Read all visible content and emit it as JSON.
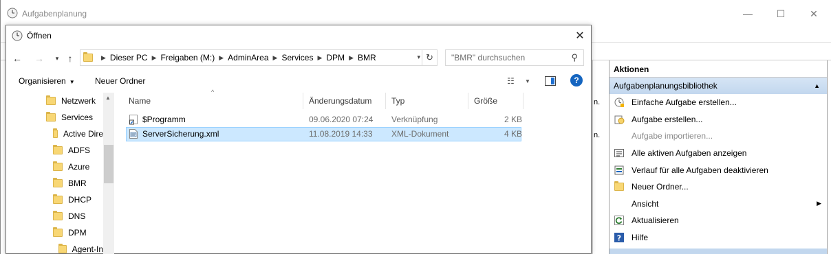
{
  "background_window": {
    "title": "Aufgabenplanung",
    "controls": {
      "minimize": "—",
      "maximize": "☐",
      "close": "✕"
    },
    "strip_text": [
      "n.",
      "n."
    ]
  },
  "actions_panel": {
    "header": "Aktionen",
    "group_title": "Aufgabenplanungsbibliothek",
    "items": [
      {
        "label": "Einfache Aufgabe erstellen...",
        "icon": "wizard-icon",
        "enabled": true
      },
      {
        "label": "Aufgabe erstellen...",
        "icon": "task-icon",
        "enabled": true
      },
      {
        "label": "Aufgabe importieren...",
        "icon": "",
        "enabled": false
      },
      {
        "label": "Alle aktiven Aufgaben anzeigen",
        "icon": "list-icon",
        "enabled": true
      },
      {
        "label": "Verlauf für alle Aufgaben deaktivieren",
        "icon": "history-icon",
        "enabled": true
      },
      {
        "label": "Neuer Ordner...",
        "icon": "folder-icon",
        "enabled": true
      },
      {
        "label": "Ansicht",
        "icon": "",
        "enabled": true,
        "submenu": true
      },
      {
        "label": "Aktualisieren",
        "icon": "refresh-icon",
        "enabled": true
      },
      {
        "label": "Hilfe",
        "icon": "help-icon",
        "enabled": true
      }
    ]
  },
  "dialog": {
    "title": "Öffnen",
    "close": "✕",
    "breadcrumb": [
      "Dieser PC",
      "Freigaben (M:)",
      "AdminArea",
      "Services",
      "DPM",
      "BMR"
    ],
    "search_placeholder": "\"BMR\" durchsuchen",
    "toolbar": {
      "organize_label": "Organisieren",
      "new_folder_label": "Neuer Ordner",
      "help": "?"
    },
    "tree": [
      {
        "label": "Netzwerk",
        "indent": 1
      },
      {
        "label": "Services",
        "indent": 1
      },
      {
        "label": "Active Dire",
        "indent": 2
      },
      {
        "label": "ADFS",
        "indent": 2
      },
      {
        "label": "Azure",
        "indent": 2
      },
      {
        "label": "BMR",
        "indent": 2
      },
      {
        "label": "DHCP",
        "indent": 2
      },
      {
        "label": "DNS",
        "indent": 2
      },
      {
        "label": "DPM",
        "indent": 2
      },
      {
        "label": "Agent-In",
        "indent": 3
      }
    ],
    "columns": [
      "Name",
      "Änderungsdatum",
      "Typ",
      "Größe"
    ],
    "files": [
      {
        "name": "$Programm",
        "date": "09.06.2020 07:24",
        "type": "Verknüpfung",
        "size": "2 KB",
        "icon": "shortcut-icon",
        "selected": false
      },
      {
        "name": "ServerSicherung.xml",
        "date": "11.08.2019 14:33",
        "type": "XML-Dokument",
        "size": "4 KB",
        "icon": "xml-file-icon",
        "selected": true
      }
    ]
  }
}
